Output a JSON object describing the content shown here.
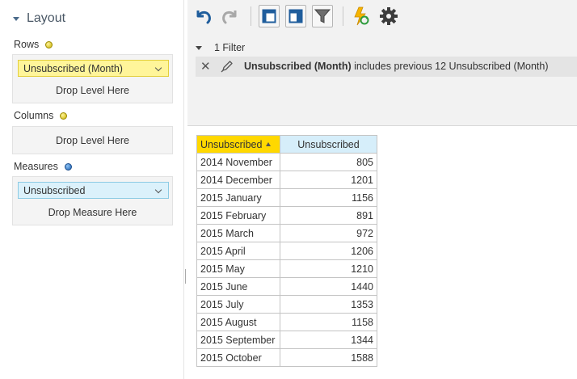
{
  "layout": {
    "title": "Layout",
    "rows": {
      "label": "Rows",
      "chip": "Unsubscribed (Month)",
      "drop_text": "Drop Level Here"
    },
    "columns": {
      "label": "Columns",
      "drop_text": "Drop Level Here"
    },
    "measures": {
      "label": "Measures",
      "chip": "Unsubscribed",
      "drop_text": "Drop Measure Here"
    }
  },
  "toolbar": {
    "icons": [
      "undo-icon",
      "redo-icon",
      "layout-icon",
      "table-layout-icon",
      "filter-icon",
      "refresh-icon",
      "gear-icon"
    ]
  },
  "filters": {
    "toggle_label": "1 Filter",
    "items": [
      {
        "bold": "Unsubscribed (Month)",
        "rest": " includes previous 12 Unsubscribed (Month)"
      }
    ]
  },
  "pivot": {
    "row_header": "Unsubscribed",
    "col_header": "Unsubscribed",
    "rows": [
      {
        "label": "2014 November",
        "value": "805"
      },
      {
        "label": "2014 December",
        "value": "1201"
      },
      {
        "label": "2015 January",
        "value": "1156"
      },
      {
        "label": "2015 February",
        "value": "891"
      },
      {
        "label": "2015 March",
        "value": "972"
      },
      {
        "label": "2015 April",
        "value": "1206"
      },
      {
        "label": "2015 May",
        "value": "1210"
      },
      {
        "label": "2015 June",
        "value": "1440"
      },
      {
        "label": "2015 July",
        "value": "1353"
      },
      {
        "label": "2015 August",
        "value": "1158"
      },
      {
        "label": "2015 September",
        "value": "1344"
      },
      {
        "label": "2015 October",
        "value": "1588"
      }
    ]
  },
  "colors": {
    "row_header_bg": "#ffd800",
    "col_header_bg": "#d6eefa",
    "rows_chip_bg": "#fff59a",
    "measure_chip_bg": "#dbf1fb",
    "toolbar_icon_blue": "#1f5d9c"
  }
}
